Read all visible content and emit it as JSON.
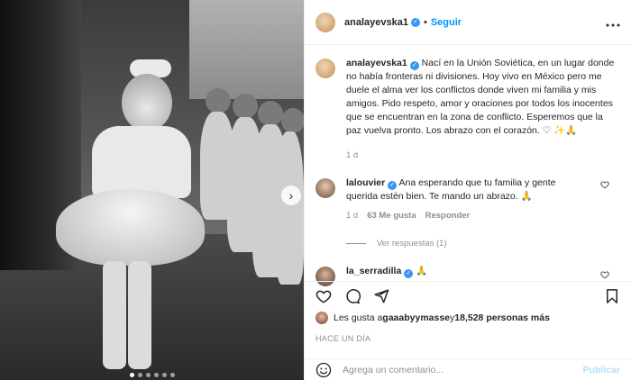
{
  "post": {
    "username": "analayevska1",
    "verified_badge": "✓",
    "dot": "•",
    "follow_label": "Seguir",
    "more_icon": "more-icon"
  },
  "caption": {
    "username": "analayevska1",
    "text": "Nací en la Unión Soviética, en un lugar donde no había fronteras ni divisiones. Hoy vivo en México pero me duele el alma ver los conflictos donde viven mi familia y mis amigos. Pido respeto, amor y oraciones por todos los inocentes que se encuentran en la zona de conflicto. Esperemos que la paz vuelva pronto. Los abrazo con el corazón. ♡ ✨🙏",
    "time": "1 d"
  },
  "comments": [
    {
      "username": "lalouvier",
      "text": "Ana esperando que tu familia y gente querida estén bien. Te mando un abrazo. 🙏",
      "time": "1 d",
      "likes": "63 Me gusta",
      "reply_label": "Responder",
      "view_replies": "Ver respuestas (1)"
    },
    {
      "username": "la_serradilla",
      "text": "🙏"
    }
  ],
  "likes": {
    "prefix": "Les gusta a ",
    "user": "gaaabyymasse",
    "middle": " y ",
    "count": "18,528 personas más"
  },
  "posted_when": "HACE UN DÍA",
  "comment_box": {
    "placeholder": "Agrega un comentario...",
    "publish_label": "Publicar"
  },
  "media": {
    "next_arrow": "›",
    "slide_count": 6,
    "current_slide": 1
  }
}
